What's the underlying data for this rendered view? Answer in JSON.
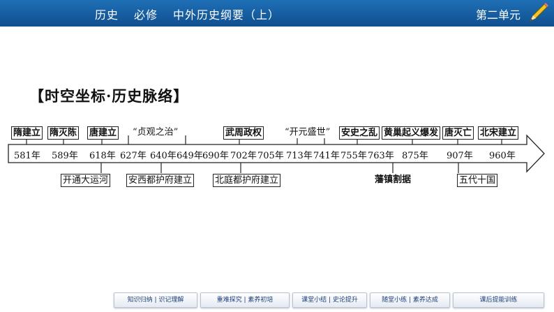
{
  "header": {
    "course_items": [
      "历史",
      "必修",
      "中外历史纲要（上）"
    ],
    "unit": "第二单元"
  },
  "section_title": "【时空坐标·历史脉络】",
  "timeline": {
    "years": [
      "581年",
      "589年",
      "618年",
      "627年",
      "640年",
      "649年",
      "690年",
      "702年",
      "705年",
      "713年",
      "741年",
      "755年",
      "763年",
      "875年",
      "907年",
      "960年"
    ],
    "events_above": [
      "隋建立",
      "隋灭陈",
      "唐建立",
      "“贞观之治”",
      "武周政权",
      "“开元盛世”",
      "安史之乱",
      "黄巢起义爆发",
      "唐灭亡",
      "北宋建立"
    ],
    "events_below": [
      "开通大运河",
      "安西都护府建立",
      "北庭都护府建立",
      "藩镇割据",
      "五代十国"
    ]
  },
  "nav": {
    "items": [
      "知识归纳 | 识记理解",
      "重难探究 | 素养初培",
      "课堂小结 | 史论提升",
      "随堂小练 | 素养达成",
      "课后提能训练"
    ]
  },
  "colors": {
    "header": "#1567b0",
    "nav_text": "#1d3f7a"
  }
}
